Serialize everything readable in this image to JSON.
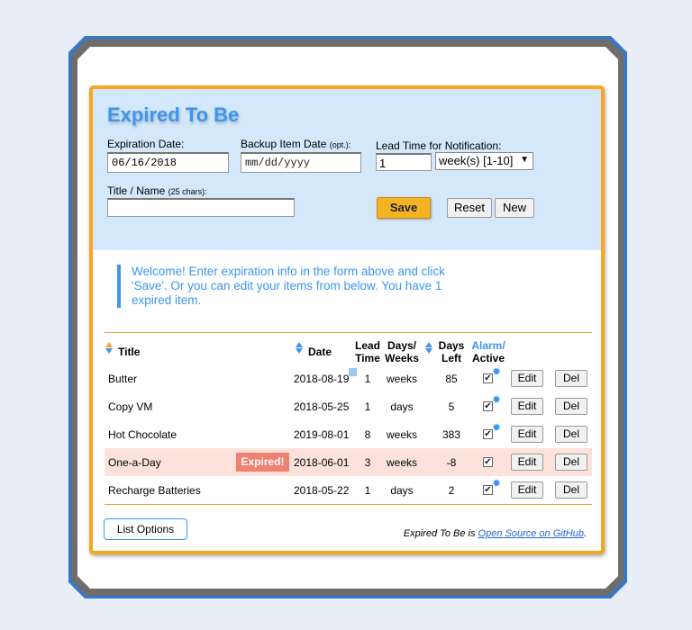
{
  "app": {
    "title": "Expired To Be"
  },
  "form": {
    "expiration_label": "Expiration Date:",
    "expiration_value": "06/16/2018",
    "backup_label": "Backup Item Date",
    "backup_opt": "(opt.):",
    "backup_placeholder": "mm/dd/yyyy",
    "lead_label": "Lead Time for Notification:",
    "lead_value": "1",
    "lead_unit": "week(s) [1-10]",
    "title_label": "Title / Name",
    "title_hint": "(25 chars):",
    "title_value": "",
    "save_label": "Save",
    "reset_label": "Reset",
    "new_label": "New"
  },
  "welcome": "Welcome! Enter expiration info in the form above and click 'Save'. Or you can edit your items from below. You have 1 expired item.",
  "table": {
    "headers": {
      "title": "Title",
      "date": "Date",
      "lead_time": [
        "Lead",
        "Time"
      ],
      "unit": [
        "Days/",
        "Weeks"
      ],
      "days_left": [
        "Days",
        "Left"
      ],
      "alarm": [
        "Alarm/",
        "Active"
      ]
    },
    "rows": [
      {
        "title": "Butter",
        "date": "2018-08-19",
        "lead": "1",
        "unit": "weeks",
        "left": "85",
        "alarm": true,
        "expired": false
      },
      {
        "title": "Copy VM",
        "date": "2018-05-25",
        "lead": "1",
        "unit": "days",
        "left": "5",
        "alarm": true,
        "expired": false
      },
      {
        "title": "Hot Chocolate",
        "date": "2019-08-01",
        "lead": "8",
        "unit": "weeks",
        "left": "383",
        "alarm": true,
        "expired": false
      },
      {
        "title": "One-a-Day",
        "date": "2018-06-01",
        "lead": "3",
        "unit": "weeks",
        "left": "-8",
        "alarm": false,
        "expired": true,
        "badge": "Expired!"
      },
      {
        "title": "Recharge Batteries",
        "date": "2018-05-22",
        "lead": "1",
        "unit": "days",
        "left": "2",
        "alarm": true,
        "expired": false
      }
    ],
    "edit_label": "Edit",
    "del_label": "Del"
  },
  "footer": {
    "list_options": "List Options",
    "prefix": "Expired To Be is",
    "link": "Open Source on GitHub",
    "suffix": "."
  },
  "colors": {
    "accent": "#3b96f0",
    "orange": "#f5a623",
    "expired_bg": "#fde2dc",
    "badge": "#f08070"
  }
}
